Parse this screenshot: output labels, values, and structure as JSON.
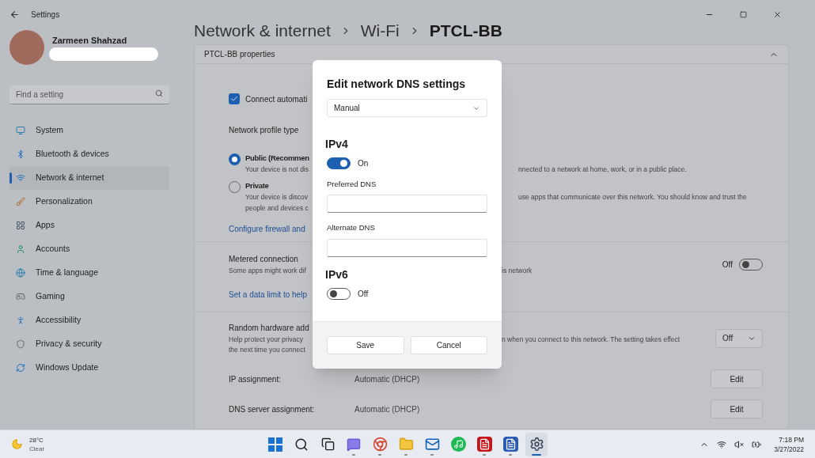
{
  "window": {
    "title": "Settings"
  },
  "profile": {
    "name": "Zarmeen Shahzad"
  },
  "search": {
    "placeholder": "Find a setting"
  },
  "nav": [
    {
      "kind": "system",
      "label": "System",
      "selected": false
    },
    {
      "kind": "bluetooth",
      "label": "Bluetooth & devices",
      "selected": false
    },
    {
      "kind": "network",
      "label": "Network & internet",
      "selected": true
    },
    {
      "kind": "personalization",
      "label": "Personalization",
      "selected": false
    },
    {
      "kind": "apps",
      "label": "Apps",
      "selected": false
    },
    {
      "kind": "accounts",
      "label": "Accounts",
      "selected": false
    },
    {
      "kind": "time",
      "label": "Time & language",
      "selected": false
    },
    {
      "kind": "gaming",
      "label": "Gaming",
      "selected": false
    },
    {
      "kind": "accessibility",
      "label": "Accessibility",
      "selected": false
    },
    {
      "kind": "privacy",
      "label": "Privacy & security",
      "selected": false
    },
    {
      "kind": "update",
      "label": "Windows Update",
      "selected": false
    }
  ],
  "breadcrumb": [
    "Network & internet",
    "Wi-Fi",
    "PTCL-BB"
  ],
  "properties": {
    "title": "PTCL-BB properties",
    "expanded": true,
    "connect_auto": {
      "label": "Connect automati",
      "checked": true
    },
    "profile_type": "Network profile type",
    "profile_options": [
      {
        "label": "Public (Recommen",
        "selected": true,
        "lines": [
          {
            "left": "Your device is not dis",
            "right": "nnected to a network at home, work, or in a public place."
          }
        ]
      },
      {
        "label": "Private",
        "selected": false,
        "lines": [
          {
            "left": "Your device is discov",
            "right": "use apps that communicate over this network. You should know and trust the"
          },
          {
            "left": "people and devices c"
          }
        ]
      }
    ],
    "firewall_link": "Configure firewall and",
    "metered": {
      "label": "Metered connection",
      "left": "Some apps might work dif",
      "right": "is network",
      "state": "Off",
      "on": false
    },
    "data_limit_link": "Set a data limit to help",
    "random_hw": {
      "label": "Random hardware add",
      "lines": [
        {
          "left": "Help protect your privacy",
          "right": "n when you connect to this network. The setting takes effect"
        },
        {
          "left": "the next time you connect"
        }
      ],
      "value": "Off"
    },
    "assignments": [
      {
        "label": "IP assignment:",
        "value": "Automatic (DHCP)",
        "button": "Edit"
      },
      {
        "label": "DNS server assignment:",
        "value": "Automatic (DHCP)",
        "button": "Edit"
      }
    ]
  },
  "dialog": {
    "title": "Edit network DNS settings",
    "mode": "Manual",
    "sections": [
      {
        "heading": "IPv4",
        "on": true,
        "state": "On",
        "fields": [
          {
            "label": "Preferred DNS"
          },
          {
            "label": "Alternate DNS"
          }
        ]
      },
      {
        "heading": "IPv6",
        "on": false,
        "state": "Off"
      }
    ],
    "buttons": [
      "Save",
      "Cancel"
    ]
  },
  "taskbar": {
    "weather": {
      "temp": "28°C",
      "condition": "Clear"
    },
    "apps": [
      {
        "kind": "start",
        "running": false,
        "selected": false
      },
      {
        "kind": "search",
        "running": false,
        "selected": false
      },
      {
        "kind": "taskview",
        "running": false,
        "selected": false
      },
      {
        "kind": "chat",
        "running": true,
        "selected": false
      },
      {
        "kind": "chrome",
        "running": true,
        "selected": false
      },
      {
        "kind": "files",
        "running": true,
        "selected": false
      },
      {
        "kind": "outlook",
        "running": true,
        "selected": false
      },
      {
        "kind": "spotify",
        "running": false,
        "selected": false
      },
      {
        "kind": "acrobat",
        "running": true,
        "selected": false
      },
      {
        "kind": "word",
        "running": true,
        "selected": false
      },
      {
        "kind": "settings",
        "running": true,
        "selected": true
      }
    ],
    "time": "7:18 PM",
    "date": "3/27/2022"
  }
}
